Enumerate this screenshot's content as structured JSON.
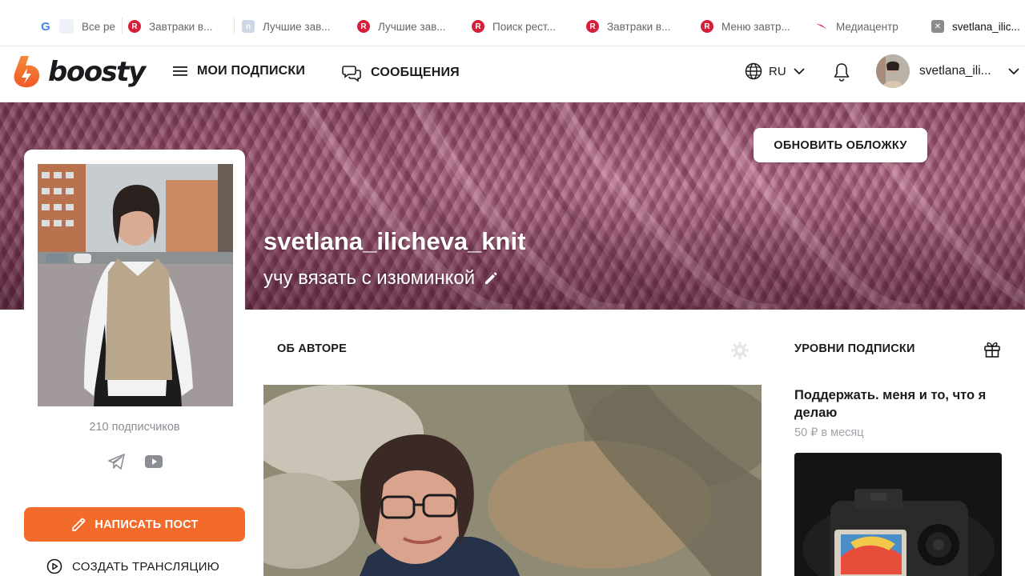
{
  "browser": {
    "tabs": [
      {
        "label": "Все ре",
        "favicon": "google-icon"
      },
      {
        "label": "Завтраки в...",
        "favicon": "restaurant-r-icon"
      },
      {
        "label": "Лучшие зав...",
        "favicon": "document-icon"
      },
      {
        "label": "Лучшие зав...",
        "favicon": "restaurant-r-icon"
      },
      {
        "label": "Поиск рест...",
        "favicon": "restaurant-r-icon"
      },
      {
        "label": "Завтраки в...",
        "favicon": "restaurant-r-icon"
      },
      {
        "label": "Меню завтр...",
        "favicon": "restaurant-r-icon"
      },
      {
        "label": "Медиацентр",
        "favicon": "mediacenter-icon"
      },
      {
        "label": "svetlana_ilic...",
        "favicon": "close-icon",
        "active": true
      }
    ]
  },
  "header": {
    "logo_text": "boosty",
    "nav": {
      "subscriptions": "МОИ ПОДПИСКИ",
      "messages": "СООБЩЕНИЯ"
    },
    "language": "RU",
    "username": "svetlana_ili..."
  },
  "cover": {
    "update_button": "ОБНОВИТЬ ОБЛОЖКУ",
    "channel_name": "svetlana_ilicheva_knit",
    "channel_description": "учу вязать с изюминкой"
  },
  "profile": {
    "subscribers": "210 подписчиков",
    "write_post_button": "НАПИСАТЬ ПОСТ",
    "create_stream_button": "СОЗДАТЬ ТРАНСЛЯЦИЮ"
  },
  "about": {
    "heading": "ОБ АВТОРЕ"
  },
  "levels": {
    "heading": "УРОВНИ ПОДПИСКИ",
    "items": [
      {
        "title": "Поддержать. меня и то, что я делаю",
        "price": "50 ₽ в месяц"
      }
    ]
  },
  "colors": {
    "accent": "#f26b2a",
    "text": "#1b1b1f",
    "muted": "#8a8d93",
    "cover": "#9a5472"
  }
}
